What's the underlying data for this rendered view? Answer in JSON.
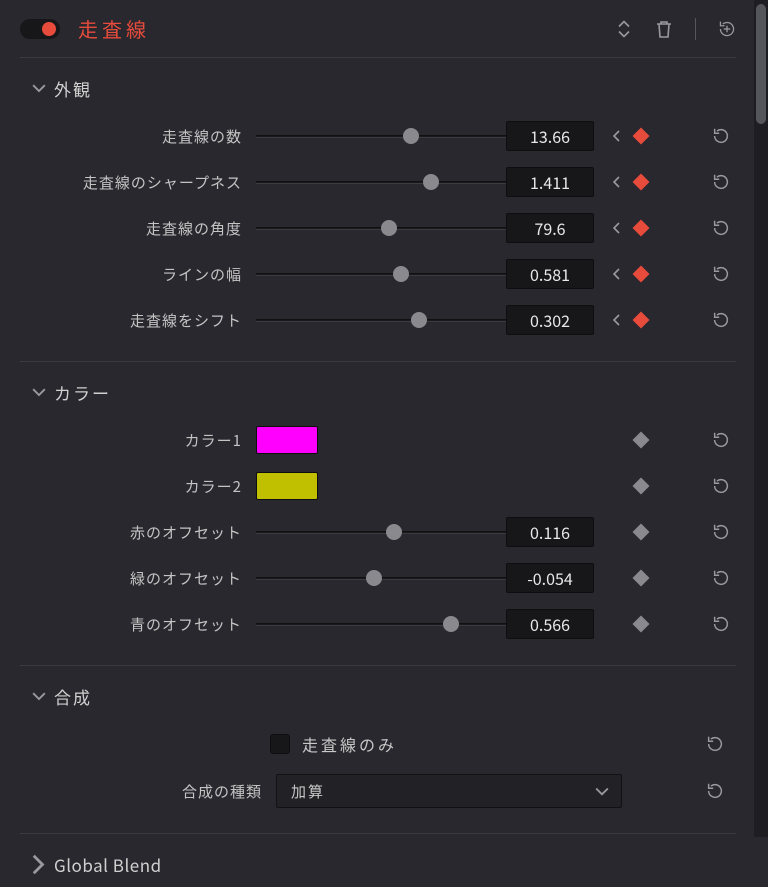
{
  "header": {
    "title": "走査線"
  },
  "sections": {
    "appearance": {
      "title": "外観",
      "params": [
        {
          "label": "走査線の数",
          "value": "13.66",
          "pos": 62,
          "keyed": true
        },
        {
          "label": "走査線のシャープネス",
          "value": "1.411",
          "pos": 70,
          "keyed": true
        },
        {
          "label": "走査線の角度",
          "value": "79.6",
          "pos": 53,
          "keyed": true
        },
        {
          "label": "ラインの幅",
          "value": "0.581",
          "pos": 58,
          "keyed": true
        },
        {
          "label": "走査線をシフト",
          "value": "0.302",
          "pos": 65,
          "keyed": true
        }
      ]
    },
    "color": {
      "title": "カラー",
      "color1_label": "カラー1",
      "color2_label": "カラー2",
      "color1": "#ff00ff",
      "color2": "#c0bf00",
      "offsets": [
        {
          "label": "赤のオフセット",
          "value": "0.116",
          "pos": 55
        },
        {
          "label": "緑のオフセット",
          "value": "-0.054",
          "pos": 47
        },
        {
          "label": "青のオフセット",
          "value": "0.566",
          "pos": 78
        }
      ]
    },
    "composite": {
      "title": "合成",
      "checkbox_label": "走査線のみ",
      "dropdown_label": "合成の種類",
      "dropdown_value": "加算"
    },
    "global_blend": {
      "title": "Global Blend"
    }
  }
}
